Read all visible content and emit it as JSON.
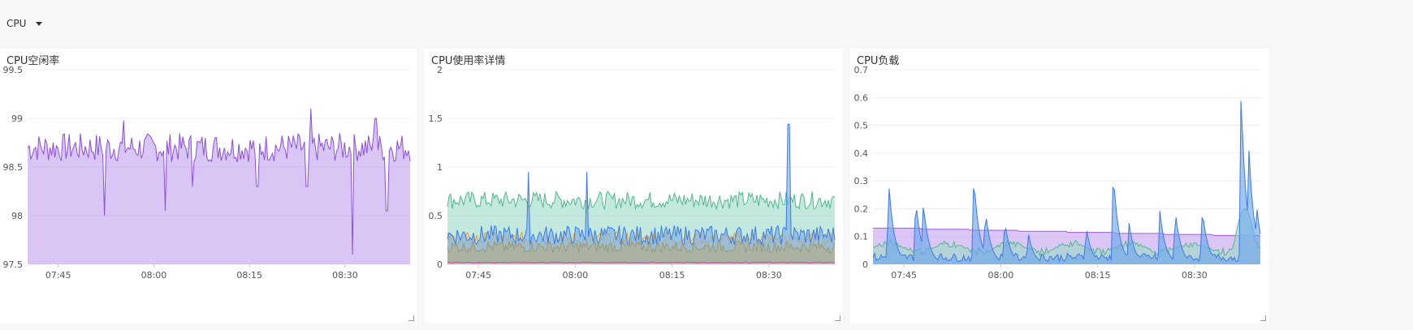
{
  "header": {
    "row_label": "CPU"
  },
  "panels": [
    {
      "title": "CPU空闲率",
      "chart_data": {
        "type": "area",
        "title": "CPU空闲率",
        "ylim": [
          97.5,
          99.5
        ],
        "yticks": [
          "99.5",
          "99",
          "98.5",
          "98",
          "97.5"
        ],
        "xticks": [
          "07:45",
          "08:00",
          "08:15",
          "08:30"
        ],
        "x_time_range": [
          "07:40",
          "08:40"
        ],
        "series": [
          {
            "color": "#8a4fe0",
            "fill": "#c6a8f0",
            "baseline": 98.7,
            "noise": 0.15,
            "dips": [
              {
                "at": 0.2,
                "to": 98.0
              },
              {
                "at": 0.36,
                "to": 98.05
              },
              {
                "at": 0.43,
                "to": 98.3
              },
              {
                "at": 0.6,
                "to": 98.3
              },
              {
                "at": 0.85,
                "to": 97.6
              },
              {
                "at": 0.94,
                "to": 98.05
              },
              {
                "at": 0.73,
                "to": 98.3
              }
            ],
            "peaks": [
              {
                "at": 0.74,
                "to": 99.1
              },
              {
                "at": 0.91,
                "to": 99.0
              },
              {
                "at": 0.25,
                "to": 98.98
              }
            ]
          }
        ]
      }
    },
    {
      "title": "CPU使用率详情",
      "chart_data": {
        "type": "area",
        "title": "CPU使用率详情",
        "ylim": [
          0,
          2
        ],
        "yticks": [
          "2",
          "1.5",
          "1",
          "0.5",
          "0"
        ],
        "xticks": [
          "07:45",
          "08:00",
          "08:15",
          "08:30"
        ],
        "x_time_range": [
          "07:40",
          "08:40"
        ],
        "series": [
          {
            "color": "#4fb88f",
            "fill": "#a3dccb",
            "baseline": 0.66,
            "noise": 0.09
          },
          {
            "color": "#e6a23c",
            "fill": "#e8c98a",
            "baseline": 0.26,
            "noise": 0.07
          },
          {
            "color": "#3c7be6",
            "fill": "#7fb0e8",
            "baseline": 0.3,
            "noise": 0.1,
            "peaks": [
              {
                "at": 0.88,
                "to": 1.44
              },
              {
                "at": 0.21,
                "to": 0.95
              },
              {
                "at": 0.36,
                "to": 0.95
              }
            ]
          },
          {
            "color": "#9a9a70",
            "fill": "#b0ac8a",
            "baseline": 0.18,
            "noise": 0.06
          },
          {
            "color": "#d04aa0",
            "fill": "#e0a0d0",
            "baseline": 0.02,
            "noise": 0.005
          }
        ]
      }
    },
    {
      "title": "CPU负载",
      "chart_data": {
        "type": "area",
        "title": "CPU负载",
        "ylim": [
          0,
          0.7
        ],
        "yticks": [
          "0.7",
          "0.6",
          "0.5",
          "0.4",
          "0.3",
          "0.2",
          "0.1",
          "0"
        ],
        "xticks": [
          "07:45",
          "08:00",
          "08:15",
          "08:30"
        ],
        "x_time_range": [
          "07:40",
          "08:40"
        ],
        "series": [
          {
            "color": "#a05ae0",
            "fill": "#c8a8f0",
            "kind": "step",
            "start": 0.13,
            "end": 0.1
          },
          {
            "color": "#4fb88f",
            "fill": "#9fd8c6",
            "kind": "smooth"
          },
          {
            "color": "#3c7be6",
            "fill": "#6ea8ec",
            "kind": "spikes",
            "spikes": [
              {
                "at": 0.04,
                "to": 0.31
              },
              {
                "at": 0.11,
                "to": 0.24
              },
              {
                "at": 0.13,
                "to": 0.22
              },
              {
                "at": 0.26,
                "to": 0.32
              },
              {
                "at": 0.29,
                "to": 0.2
              },
              {
                "at": 0.34,
                "to": 0.16
              },
              {
                "at": 0.4,
                "to": 0.12
              },
              {
                "at": 0.55,
                "to": 0.14
              },
              {
                "at": 0.62,
                "to": 0.34
              },
              {
                "at": 0.66,
                "to": 0.16
              },
              {
                "at": 0.74,
                "to": 0.2
              },
              {
                "at": 0.78,
                "to": 0.2
              },
              {
                "at": 0.85,
                "to": 0.2
              },
              {
                "at": 0.95,
                "to": 0.62
              },
              {
                "at": 0.97,
                "to": 0.43
              },
              {
                "at": 0.99,
                "to": 0.22
              }
            ]
          }
        ]
      }
    }
  ]
}
